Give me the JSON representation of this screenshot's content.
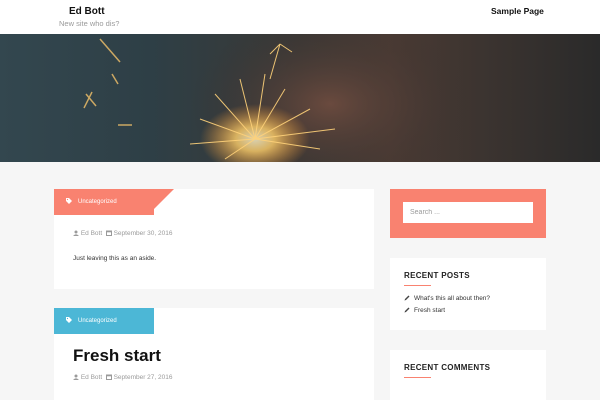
{
  "header": {
    "site_title": "Ed Bott",
    "site_description": "New site who dis?",
    "nav": [
      {
        "label": "Sample Page"
      }
    ]
  },
  "hero": {
    "image": "sparkler-photo"
  },
  "posts": [
    {
      "category": "Uncategorized",
      "category_color": "#f98270",
      "author": "Ed Bott",
      "date": "September 30, 2016",
      "excerpt": "Just leaving this as an aside."
    },
    {
      "category": "Uncategorized",
      "category_color": "#4cb7d6",
      "title": "Fresh start",
      "author": "Ed Bott",
      "date": "September 27, 2016"
    }
  ],
  "sidebar": {
    "search": {
      "placeholder": "Search ..."
    },
    "recent_posts": {
      "title": "RECENT POSTS",
      "items": [
        {
          "label": "What's this all about then?"
        },
        {
          "label": "Fresh start"
        }
      ]
    },
    "recent_comments": {
      "title": "RECENT COMMENTS"
    }
  },
  "colors": {
    "accent": "#f98270",
    "secondary": "#4cb7d6",
    "background": "#f6f6f6"
  }
}
